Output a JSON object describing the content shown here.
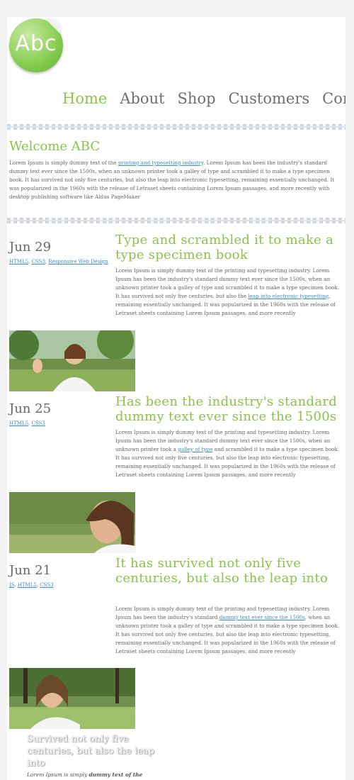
{
  "logo": {
    "text": "Abc"
  },
  "nav": [
    "Home",
    "About",
    "Shop",
    "Customers",
    "Contact"
  ],
  "welcome": {
    "title": "Welcome ABC",
    "text_before": "Lorem Ipsum is simply dummy text of the ",
    "link": "printing and typesetting industry",
    "text_after": ". Lorem Ipsum has been the industry's standard dummy text ever since the 1500s, when an unknown printer took a galley of type and scrambled it to make a type specimen book. It has survived not only five centuries, but also the leap into electronic typesetting, remaining essentially unchanged. It was popularized in the 1960s with the release of Letraset sheets containing Lorem Ipsum passages, and more recently with desktop publishing software like Aldus PageMaker"
  },
  "posts": [
    {
      "date": "Jun 29",
      "tags": [
        "HTML5",
        "CSS3",
        "Responsive Web Design"
      ],
      "title": "Type and scrambled it to make a type specimen book",
      "text_before": "Lorem Ipsum is simply dummy text of the printing and typesetting industry. Lorem Ipsum has been the industry's standard dummy text ever since the 1500s, when an unknown printer took a galley of type and scrambled it to make a type specimen book. It has survived not only five centuries, but also the ",
      "link": "leap into electronic typesetting",
      "text_after": ", remaining essentially unchanged. It was popularized in the 1960s with the release of Letraset sheets containing Lorem Ipsum passages, and more recently"
    },
    {
      "date": "Jun 25",
      "tags": [
        "HTML5",
        "CSS3"
      ],
      "title": "Has been the industry's standard dummy text ever since the 1500s",
      "text_before": "Lorem Ipsum is simply dummy text of the printing and typesetting industry. Lorem Ipsum has been the industry's standard dummy text ever since the 1500s, when an unknown printer took a ",
      "link": "galley of type",
      "text_after": " and scrambled it to make a type specimen book. It has survived not only five centuries, but also the leap into electronic typesetting, remaining essentially unchanged. It was popularized in the 1960s with the release of Letraset sheets containing Lorem Ipsum passages, and more recently"
    },
    {
      "date": "Jun 21",
      "tags": [
        "JS",
        "HTML5",
        "CSS3"
      ],
      "title": "It has survived not only five centuries, but also the leap into",
      "text_before": "Lorem Ipsum is simply dummy text of the printing and typesetting industry. Lorem Ipsum has been the industry's standard ",
      "link": "dummy text ever since the 1500s",
      "text_after": ", when an unknown printer took a galley of type and scrambled it to make a type specimen book. It has survived not only five centuries, but also the leap into electronic typesetting, remaining essentially unchanged. It was popularized in the 1960s with the release of Letraset sheets containing Lorem Ipsum passages, and more recently"
    }
  ],
  "footer": {
    "title": "Survived not only five centuries, but also the leap into",
    "text_plain": "Lorem Ipsum is simply ",
    "text_bold": "dummy text of the"
  },
  "colors": {
    "accent": "#8bc34a",
    "link": "#3e8ed0",
    "text": "#666666"
  }
}
